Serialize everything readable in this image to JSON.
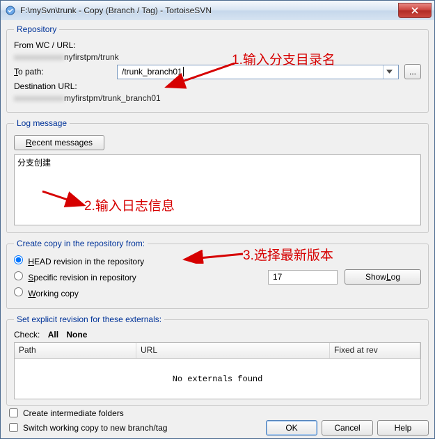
{
  "window": {
    "title": "F:\\mySvn\\trunk - Copy (Branch / Tag) - TortoiseSVN"
  },
  "repo": {
    "legend": "Repository",
    "from_label": "From WC / URL:",
    "from_value_blur": "xxxxxxxxxxxx",
    "from_value_tail": "nyfirstpm/trunk",
    "to_label": "To path:",
    "to_value": "/trunk_branch01",
    "dest_label": "Destination URL:",
    "dest_value_blur": "xxxxxxxxxxxx",
    "dest_value_tail": "myfirstpm/trunk_branch01",
    "browse_btn": "..."
  },
  "log": {
    "legend": "Log message",
    "recent_btn": "Recent messages",
    "text": "分支创建"
  },
  "copyfrom": {
    "legend": "Create copy in the repository from:",
    "opt_head": "HEAD revision in the repository",
    "opt_specific": "Specific revision in repository",
    "opt_wc": "Working copy",
    "rev_value": "17",
    "showlog_btn": "Show Log"
  },
  "externals": {
    "legend": "Set explicit revision for these externals:",
    "check_label": "Check:",
    "all": "All",
    "none": "None",
    "col_path": "Path",
    "col_url": "URL",
    "col_fixed": "Fixed at rev",
    "empty": "No externals found"
  },
  "bottom": {
    "create_intermediate": "Create intermediate folders",
    "switch_wc": "Switch working copy to new branch/tag",
    "ok": "OK",
    "cancel": "Cancel",
    "help": "Help"
  },
  "anno": {
    "a1": "1.输入分支目录名",
    "a2": "2.输入日志信息",
    "a3": "3.选择最新版本"
  }
}
